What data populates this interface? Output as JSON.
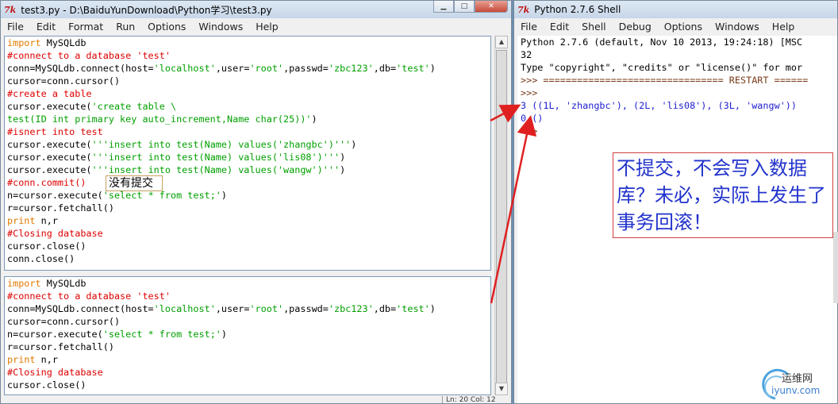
{
  "left_window": {
    "title": "test3.py - D:\\BaiduYunDownload\\Python学习\\test3.py",
    "icon": "7k",
    "controls": [
      "minimize-icon",
      "maximize-icon",
      "close-icon"
    ],
    "menu": [
      "File",
      "Edit",
      "Format",
      "Run",
      "Options",
      "Windows",
      "Help"
    ],
    "status": "Ln: 20 Col: 12"
  },
  "code_top": [
    [
      {
        "t": "import",
        "c": "kw"
      },
      {
        "t": " MySQLdb",
        "c": ""
      }
    ],
    [
      {
        "t": "#connect to a database 'test'",
        "c": "cm"
      }
    ],
    [
      {
        "t": "conn=MySQLdb.connect(host=",
        "c": ""
      },
      {
        "t": "'localhost'",
        "c": "st"
      },
      {
        "t": ",user=",
        "c": ""
      },
      {
        "t": "'root'",
        "c": "st"
      },
      {
        "t": ",passwd=",
        "c": ""
      },
      {
        "t": "'zbc123'",
        "c": "st"
      },
      {
        "t": ",db=",
        "c": ""
      },
      {
        "t": "'test'",
        "c": "st"
      },
      {
        "t": ")",
        "c": ""
      }
    ],
    [
      {
        "t": "cursor=conn.cursor()",
        "c": ""
      }
    ],
    [
      {
        "t": "#create a table",
        "c": "cm"
      }
    ],
    [
      {
        "t": "cursor.execute(",
        "c": ""
      },
      {
        "t": "'create table \\",
        "c": "st"
      }
    ],
    [
      {
        "t": "test(ID int primary key auto_increment,Name char(25))'",
        "c": "st"
      },
      {
        "t": ")",
        "c": ""
      }
    ],
    [
      {
        "t": "#isnert into test",
        "c": "cm"
      }
    ],
    [
      {
        "t": "cursor.execute(",
        "c": ""
      },
      {
        "t": "'''insert into test(Name) values('zhangbc')'''",
        "c": "st"
      },
      {
        "t": ")",
        "c": ""
      }
    ],
    [
      {
        "t": "cursor.execute(",
        "c": ""
      },
      {
        "t": "'''insert into test(Name) values('lis08')'''",
        "c": "st"
      },
      {
        "t": ")",
        "c": ""
      }
    ],
    [
      {
        "t": "cursor.execute(",
        "c": ""
      },
      {
        "t": "'''insert into test(Name) values('wangw')'''",
        "c": "st"
      },
      {
        "t": ")",
        "c": ""
      }
    ],
    [
      {
        "t": "#conn.commit()",
        "c": "cm"
      }
    ],
    [
      {
        "t": "n=cursor.execute(",
        "c": ""
      },
      {
        "t": "'select * from test;'",
        "c": "st"
      },
      {
        "t": ")",
        "c": ""
      }
    ],
    [
      {
        "t": "r=cursor.fetchall()",
        "c": ""
      }
    ],
    [
      {
        "t": "print",
        "c": "kw"
      },
      {
        "t": " n,r",
        "c": ""
      }
    ],
    [
      {
        "t": "#Closing database",
        "c": "cm"
      }
    ],
    [
      {
        "t": "cursor.close()",
        "c": ""
      }
    ],
    [
      {
        "t": "conn.close()",
        "c": ""
      }
    ]
  ],
  "code_bottom": [
    [
      {
        "t": "import",
        "c": "kw"
      },
      {
        "t": " MySQLdb",
        "c": ""
      }
    ],
    [
      {
        "t": "#connect to a database 'test'",
        "c": "cm"
      }
    ],
    [
      {
        "t": "conn=MySQLdb.connect(host=",
        "c": ""
      },
      {
        "t": "'localhost'",
        "c": "st"
      },
      {
        "t": ",user=",
        "c": ""
      },
      {
        "t": "'root'",
        "c": "st"
      },
      {
        "t": ",passwd=",
        "c": ""
      },
      {
        "t": "'zbc123'",
        "c": "st"
      },
      {
        "t": ",db=",
        "c": ""
      },
      {
        "t": "'test'",
        "c": "st"
      },
      {
        "t": ")",
        "c": ""
      }
    ],
    [
      {
        "t": "cursor=conn.cursor()",
        "c": ""
      }
    ],
    [
      {
        "t": "n=cursor.execute(",
        "c": ""
      },
      {
        "t": "'select * from test;'",
        "c": "st"
      },
      {
        "t": ")",
        "c": ""
      }
    ],
    [
      {
        "t": "r=cursor.fetchall()",
        "c": ""
      }
    ],
    [
      {
        "t": "print",
        "c": "kw"
      },
      {
        "t": " n,r",
        "c": ""
      }
    ],
    [
      {
        "t": "#Closing database",
        "c": "cm"
      }
    ],
    [
      {
        "t": "cursor.close()",
        "c": ""
      }
    ]
  ],
  "annotation_small": "没有提交",
  "right_window": {
    "title": "Python 2.7.6 Shell",
    "icon": "7k",
    "menu": [
      "File",
      "Edit",
      "Shell",
      "Debug",
      "Options",
      "Windows",
      "Help"
    ]
  },
  "shell_lines": [
    [
      {
        "t": "Python 2.7.6 (default, Nov 10 2013, 19:24:18) [MSC",
        "c": ""
      }
    ],
    [
      {
        "t": "32",
        "c": ""
      }
    ],
    [
      {
        "t": "Type \"copyright\", \"credits\" or \"license()\" for mor",
        "c": ""
      }
    ],
    [
      {
        "t": ">>> ================================ RESTART ======",
        "c": "brown"
      }
    ],
    [
      {
        "t": ">>>",
        "c": "brown"
      }
    ],
    [
      {
        "t": "3 ((1L, 'zhangbc'), (2L, 'lis08'), (3L, 'wangw'))",
        "c": "blue"
      }
    ],
    [
      {
        "t": "0 ()",
        "c": "blue"
      }
    ],
    [
      {
        "t": ">>>",
        "c": "brown"
      }
    ]
  ],
  "annotation_big": "不提交，不会写入数据库？未必，实际上发生了事务回滚！",
  "watermark": {
    "line1": "运维网",
    "line2": "iyunv.com"
  },
  "colors": {
    "keyword": "#e07a00",
    "comment": "#dd0000",
    "string": "#00a000",
    "output": "#2020d0",
    "prompt": "#7a3b1a",
    "arrow": "#e02020"
  }
}
